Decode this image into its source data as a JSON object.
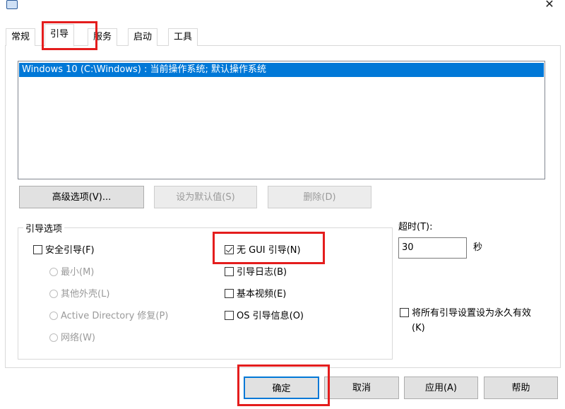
{
  "window": {
    "close_glyph": "✕",
    "app_icon": "msconfig-icon"
  },
  "tabs": [
    {
      "label": "常规"
    },
    {
      "label": "引导"
    },
    {
      "label": "服务"
    },
    {
      "label": "启动"
    },
    {
      "label": "工具"
    }
  ],
  "os_list": {
    "items": [
      "Windows 10 (C:\\Windows) : 当前操作系统; 默认操作系统"
    ]
  },
  "buttons": {
    "advanced": "高级选项(V)...",
    "set_default": "设为默认值(S)",
    "delete": "删除(D)"
  },
  "boot_options": {
    "label": "引导选项",
    "safe_boot": "安全引导(F)",
    "minimal": "最小(M)",
    "alternate_shell": "其他外壳(L)",
    "ad_repair": "Active Directory 修复(P)",
    "network": "网络(W)",
    "no_gui_boot": "无 GUI 引导(N)",
    "boot_log": "引导日志(B)",
    "base_video": "基本视频(E)",
    "os_boot_info": "OS 引导信息(O)"
  },
  "timeout": {
    "label": "超时(T):",
    "value": "30",
    "unit": "秒"
  },
  "permanent": {
    "line1": "将所有引导设置设为永久有效",
    "line2": "(K)"
  },
  "footer": {
    "ok": "确定",
    "cancel": "取消",
    "apply": "应用(A)",
    "help": "帮助"
  },
  "colors": {
    "selection": "#0078d7",
    "highlight": "#e41d1d"
  }
}
